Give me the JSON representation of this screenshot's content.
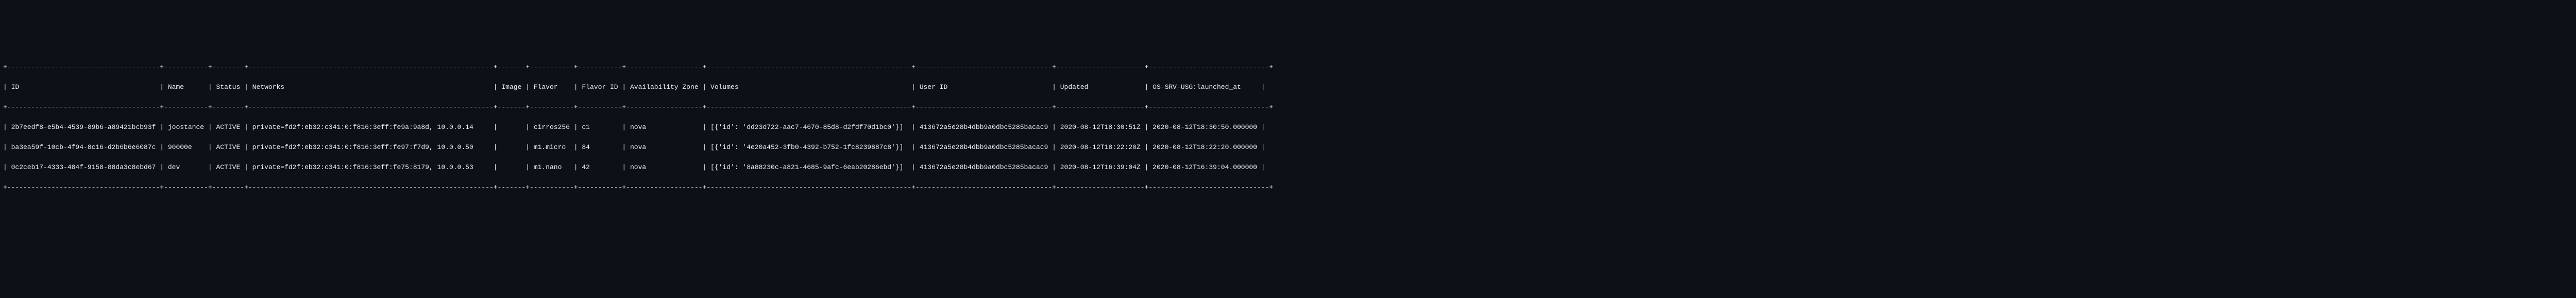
{
  "table": {
    "border_top": "+--------------------------------------+-----------+--------+-------------------------------------------------------------+-------+-----------+-----------+-------------------+---------------------------------------------------+----------------------------------+----------------------+------------------------------+",
    "header_line1": "| ID                                   | Name      | Status | Networks                                                    | Image | Flavor    | Flavor ID | Availability Zone | Volumes                                           | User ID                          | Updated              | OS-SRV-USG:launched_at     |",
    "border_mid": "+--------------------------------------+-----------+--------+-------------------------------------------------------------+-------+-----------+-----------+-------------------+---------------------------------------------------+----------------------------------+----------------------+------------------------------+",
    "row1": "| 2b7eedf8-e5b4-4539-89b6-a89421bcb93f | joostance | ACTIVE | private=fd2f:eb32:c341:0:f816:3eff:fe9a:9a8d, 10.0.0.14     |       | cirros256 | c1        | nova              | [{'id': 'dd23d722-aac7-4670-85d8-d2fdf70d1bc0'}]  | 413672a5e28b4dbb9a0dbc5285bacac9 | 2020-08-12T18:30:51Z | 2020-08-12T18:30:50.000000 |",
    "row2": "| ba3ea59f-10cb-4f94-8c16-d2b6b6e6087c | 90000e    | ACTIVE | private=fd2f:eb32:c341:0:f816:3eff:fe97:f7d9, 10.0.0.50     |       | m1.micro  | 84        | nova              | [{'id': '4e20a452-3fb0-4392-b752-1fc8239887c8'}]  | 413672a5e28b4dbb9a0dbc5285bacac9 | 2020-08-12T18:22:20Z | 2020-08-12T18:22:20.000000 |",
    "row3": "| 0c2ceb17-4333-484f-9158-88da3c8ebd67 | dev       | ACTIVE | private=fd2f:eb32:c341:0:f816:3eff:fe75:8179, 10.0.0.53     |       | m1.nano   | 42        | nova              | [{'id': '8a88230c-a821-4685-9afc-6eab20286ebd'}]  | 413672a5e28b4dbb9a0dbc5285bacac9 | 2020-08-12T16:39:04Z | 2020-08-12T16:39:04.000000 |",
    "border_bot": "+--------------------------------------+-----------+--------+-------------------------------------------------------------+-------+-----------+-----------+-------------------+---------------------------------------------------+----------------------------------+----------------------+------------------------------+"
  },
  "columns": [
    "ID",
    "Name",
    "Status",
    "Networks",
    "Image",
    "Flavor",
    "Flavor ID",
    "Availability Zone",
    "Volumes",
    "User ID",
    "Updated",
    "OS-SRV-USG:launched_at"
  ],
  "rows": [
    {
      "id": "2b7eedf8-e5b4-4539-89b6-a89421bcb93f",
      "name": "joostance",
      "status": "ACTIVE",
      "networks": "private=fd2f:eb32:c341:0:f816:3eff:fe9a:9a8d, 10.0.0.14",
      "image": "",
      "flavor": "cirros256",
      "flavor_id": "c1",
      "availability_zone": "nova",
      "volumes": "[{'id': 'dd23d722-aac7-4670-85d8-d2fdf70d1bc0'}]",
      "user_id": "413672a5e28b4dbb9a0dbc5285bacac9",
      "updated": "2020-08-12T18:30:51Z",
      "launched_at": "2020-08-12T18:30:50.000000"
    },
    {
      "id": "ba3ea59f-10cb-4f94-8c16-d2b6b6e6087c",
      "name": "90000e",
      "status": "ACTIVE",
      "networks": "private=fd2f:eb32:c341:0:f816:3eff:fe97:f7d9, 10.0.0.50",
      "image": "",
      "flavor": "m1.micro",
      "flavor_id": "84",
      "availability_zone": "nova",
      "volumes": "[{'id': '4e20a452-3fb0-4392-b752-1fc8239887c8'}]",
      "user_id": "413672a5e28b4dbb9a0dbc5285bacac9",
      "updated": "2020-08-12T18:22:20Z",
      "launched_at": "2020-08-12T18:22:20.000000"
    },
    {
      "id": "0c2ceb17-4333-484f-9158-88da3c8ebd67",
      "name": "dev",
      "status": "ACTIVE",
      "networks": "private=fd2f:eb32:c341:0:f816:3eff:fe75:8179, 10.0.0.53",
      "image": "",
      "flavor": "m1.nano",
      "flavor_id": "42",
      "availability_zone": "nova",
      "volumes": "[{'id': '8a88230c-a821-4685-9afc-6eab20286ebd'}]",
      "user_id": "413672a5e28b4dbb9a0dbc5285bacac9",
      "updated": "2020-08-12T16:39:04Z",
      "launched_at": "2020-08-12T16:39:04.000000"
    }
  ]
}
